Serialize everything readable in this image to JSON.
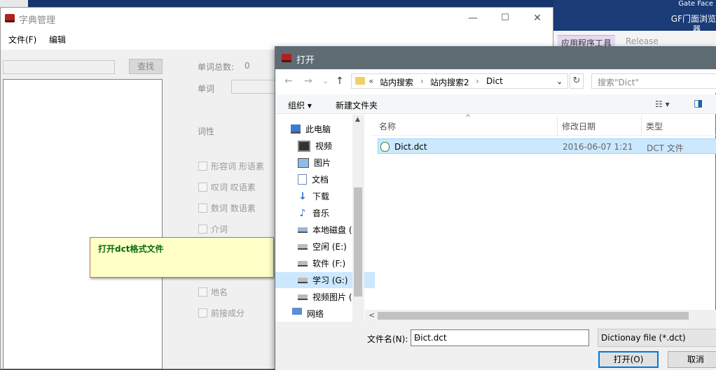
{
  "desktop": {
    "gate_face": "Gate Face",
    "gf_line1": "GF门面浏览",
    "gf_line2": "器"
  },
  "main_window": {
    "title": "字典管理",
    "min_glyph": "—",
    "max_glyph": "☐",
    "close_glyph": "✕",
    "menu": [
      "文件(F)",
      "编辑"
    ],
    "search_button": "查找",
    "word_count_label": "单词总数:",
    "word_count_value": "0",
    "word_label": "单词",
    "pos_label": "词性",
    "checkboxes": [
      "形容词 形语素",
      "叹词 叹语素",
      "数词 数语素",
      "介词",
      "地名",
      "前接成分"
    ],
    "tooltip": "打开dct格式文件"
  },
  "ribbon": {
    "tab_app_tools": "应用程序工具",
    "tab_release": "Release"
  },
  "dialog": {
    "title": "打开",
    "nav_back": "←",
    "nav_forward": "→",
    "nav_recent": "⌄",
    "nav_up": "↑",
    "address": {
      "prefix": "«",
      "crumbs": [
        "站内搜索",
        "站内搜索2",
        "Dict"
      ],
      "sep": "›",
      "dropdown": "⌄"
    },
    "refresh": "↻",
    "search_placeholder": "搜索\"Dict\"",
    "toolbar": {
      "organize": "组织 ▾",
      "new_folder": "新建文件夹",
      "view": "☷ ▾",
      "pane": "◨"
    },
    "nav_items": [
      {
        "label": "此电脑",
        "icon": "computer-icon"
      },
      {
        "label": "视频",
        "icon": "video-folder-icon"
      },
      {
        "label": "图片",
        "icon": "pictures-folder-icon"
      },
      {
        "label": "文档",
        "icon": "documents-folder-icon"
      },
      {
        "label": "下载",
        "icon": "download-icon"
      },
      {
        "label": "音乐",
        "icon": "music-icon"
      },
      {
        "label": "本地磁盘 (",
        "icon": "local-disk-icon"
      },
      {
        "label": "空闲 (E:)",
        "icon": "drive-icon"
      },
      {
        "label": "软件 (F:)",
        "icon": "drive-icon"
      },
      {
        "label": "学习 (G:)",
        "icon": "drive-icon"
      },
      {
        "label": "视频图片 (",
        "icon": "drive-icon"
      },
      {
        "label": "网络",
        "icon": "network-icon"
      }
    ],
    "columns": {
      "name": "名称",
      "date": "修改日期",
      "type": "类型",
      "sort_glyph": "^"
    },
    "files": [
      {
        "name": "Dict.dct",
        "date": "2016-06-07 1:21",
        "type": "DCT 文件"
      }
    ],
    "hscroll_left": "<",
    "filename_label": "文件名(N):",
    "filename_value": "Dict.dct",
    "filename_dropdown": "⌄",
    "filetype": "Dictionay file (*.dct)",
    "open_button": "打开(O)",
    "cancel_button": "取消"
  }
}
